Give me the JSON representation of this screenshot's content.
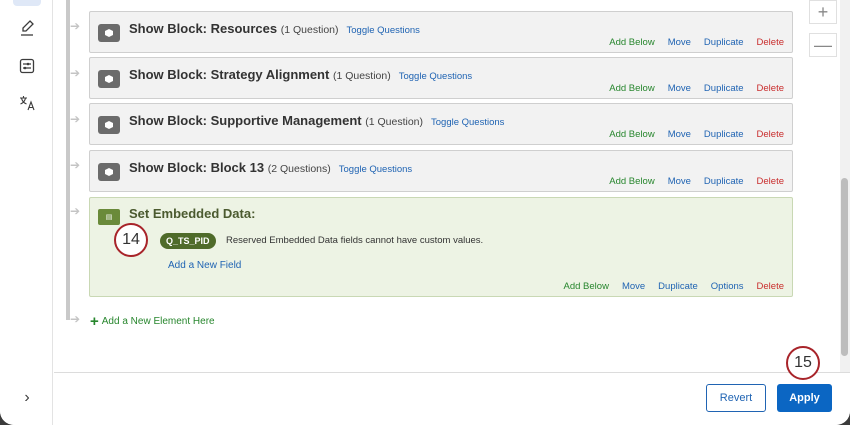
{
  "colors": {
    "accent_blue": "#2064b3",
    "action_green": "#27862d",
    "delete_red": "#c92d2d",
    "embedded_bg": "#edf3e4",
    "badge_ring": "#a8242a",
    "apply_blue": "#0b66c3"
  },
  "sidebar": {
    "icons": [
      "brush-icon",
      "settings-sliders-icon",
      "translate-icon"
    ],
    "expand_glyph": "›"
  },
  "blocks": [
    {
      "title": "Show Block: Resources",
      "count": "(1 Question)",
      "toggle": "Toggle Questions"
    },
    {
      "title": "Show Block: Strategy Alignment",
      "count": "(1 Question)",
      "toggle": "Toggle Questions"
    },
    {
      "title": "Show Block: Supportive Management",
      "count": "(1 Question)",
      "toggle": "Toggle Questions"
    },
    {
      "title": "Show Block: Block 13",
      "count": "(2 Questions)",
      "toggle": "Toggle Questions"
    }
  ],
  "block_actions": {
    "add_below": "Add Below",
    "move": "Move",
    "duplicate": "Duplicate",
    "delete": "Delete"
  },
  "embedded": {
    "title": "Set Embedded Data:",
    "field_name": "Q_TS_PID",
    "note": "Reserved Embedded Data fields cannot have custom values.",
    "add_field": "Add a New Field",
    "actions": {
      "add_below": "Add Below",
      "move": "Move",
      "duplicate": "Duplicate",
      "options": "Options",
      "delete": "Delete"
    }
  },
  "add_new_element": "Add a New Element Here",
  "badges": {
    "step_14": "14",
    "step_15": "15"
  },
  "zoom": {
    "in": "+",
    "out": "—"
  },
  "footer": {
    "revert": "Revert",
    "apply": "Apply"
  }
}
